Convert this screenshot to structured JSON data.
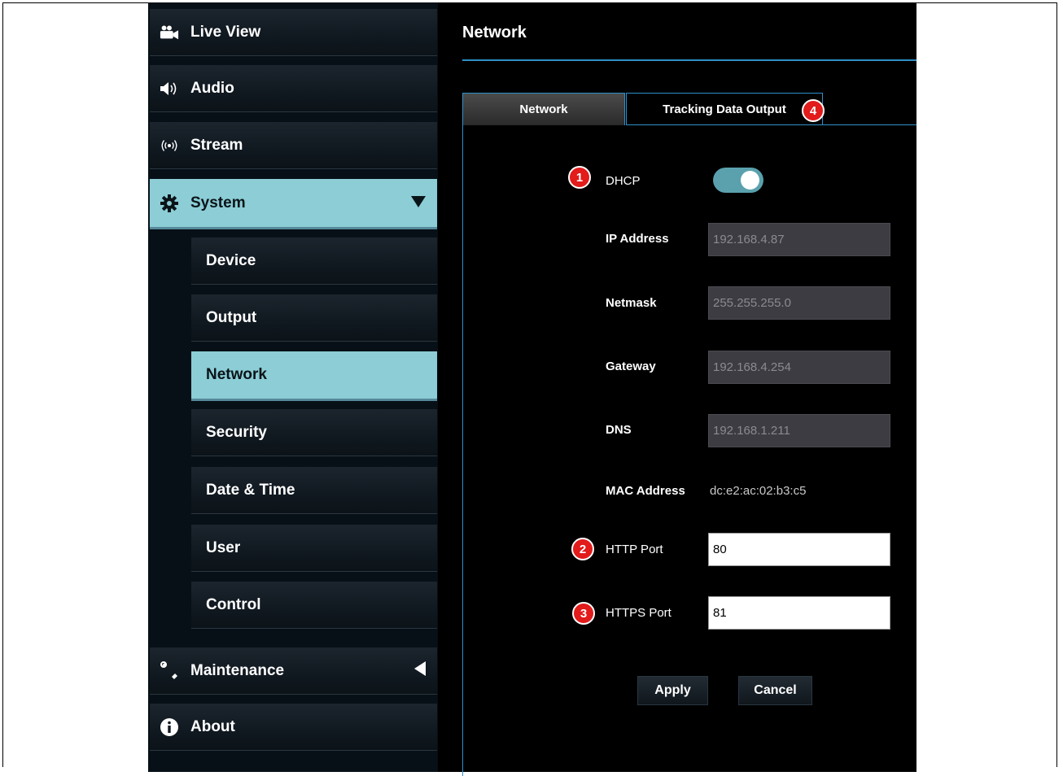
{
  "sidebar": {
    "items": [
      {
        "label": "Live View",
        "icon": "video-camera-icon"
      },
      {
        "label": "Audio",
        "icon": "speaker-icon"
      },
      {
        "label": "Stream",
        "icon": "broadcast-icon"
      },
      {
        "label": "System",
        "icon": "gear-icon",
        "expanded": true
      },
      {
        "label": "Maintenance",
        "icon": "wrench-icon",
        "expanded": false
      },
      {
        "label": "About",
        "icon": "info-icon"
      }
    ],
    "system_subitems": [
      "Device",
      "Output",
      "Network",
      "Security",
      "Date & Time",
      "User",
      "Control"
    ],
    "active_subitem": "Network",
    "active_color": "#8ccdd6"
  },
  "page": {
    "title": "Network",
    "tabs": [
      "Network",
      "Tracking Data Output"
    ],
    "active_tab": "Network"
  },
  "form": {
    "dhcp_label": "DHCP",
    "dhcp_on": true,
    "ip_label": "IP Address",
    "ip_value": "192.168.4.87",
    "netmask_label": "Netmask",
    "netmask_value": "255.255.255.0",
    "gateway_label": "Gateway",
    "gateway_value": "192.168.4.254",
    "dns_label": "DNS",
    "dns_value": "192.168.1.211",
    "mac_label": "MAC Address",
    "mac_value": "dc:e2:ac:02:b3:c5",
    "http_label": "HTTP Port",
    "http_value": "80",
    "https_label": "HTTPS Port",
    "https_value": "81",
    "apply_label": "Apply",
    "cancel_label": "Cancel"
  },
  "markers": [
    "1",
    "2",
    "3",
    "4"
  ],
  "colors": {
    "accent_line": "#2e8fc7",
    "toggle_on": "#5aa1ad",
    "marker": "#e21b1b"
  }
}
